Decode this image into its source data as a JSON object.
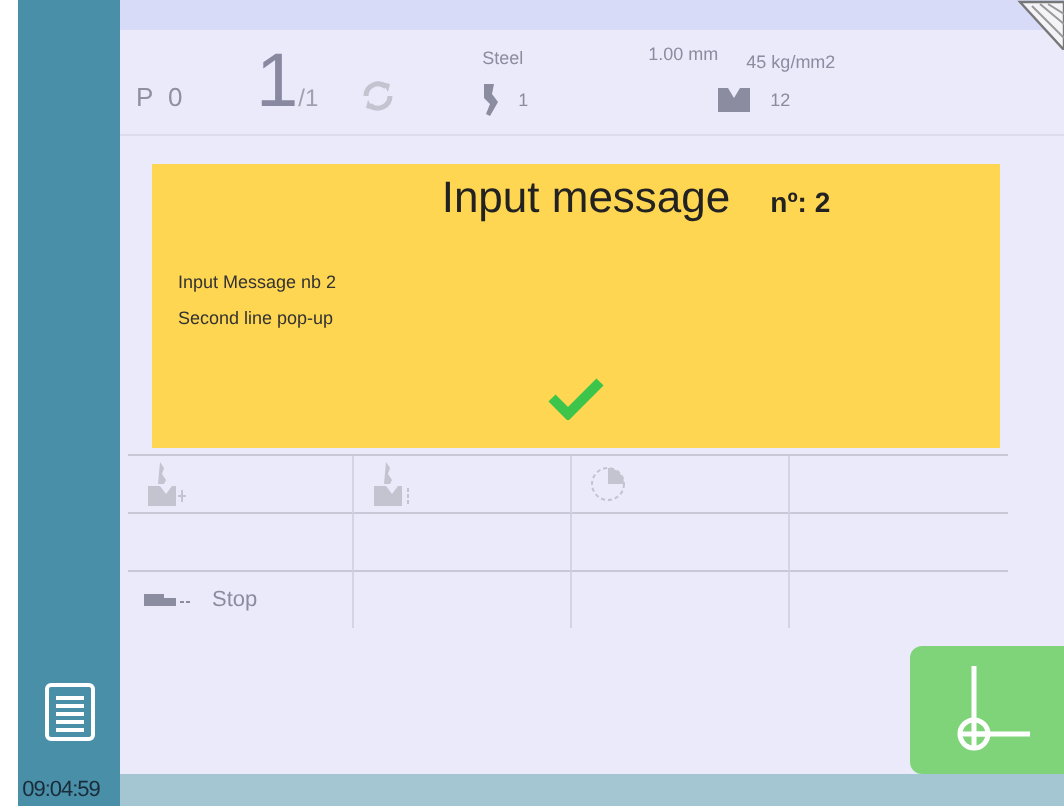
{
  "header": {
    "program": "P 0",
    "count": "1",
    "total": "/1",
    "material": "Steel",
    "thickness": "1.00 mm",
    "strength": "45 kg/mm2",
    "punch": "1",
    "die": "12"
  },
  "dialog": {
    "title": "Input message",
    "number": "nº: 2",
    "lines": [
      "Input Message nb 2",
      "Second line pop-up"
    ]
  },
  "steps": {
    "stop_label": "Stop"
  },
  "status_bar": {
    "time": "09:04:59"
  }
}
